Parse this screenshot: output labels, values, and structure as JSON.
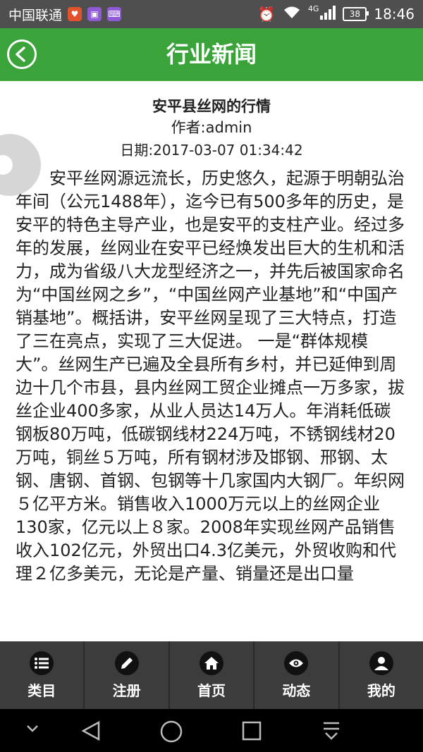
{
  "status_bar": {
    "carrier": "中国联通",
    "network": "4G",
    "battery": "38",
    "time": "18:46"
  },
  "header": {
    "title": "行业新闻"
  },
  "article": {
    "title": "安平县丝网的行情",
    "author": "作者:admin",
    "date": "日期:2017-03-07 01:34:42",
    "body": "安平丝网源远流长，历史悠久，起源于明朝弘治年间（公元1488年），迄今已有500多年的历史，是安平的特色主导产业，也是安平的支柱产业。经过多年的发展，丝网业在安平已经焕发出巨大的生机和活力，成为省级八大龙型经济之一，并先后被国家命名为“中国丝网之乡”，“中国丝网产业基地”和“中国产销基地”。概括讲，安平丝网呈现了三大特点，打造了三在亮点，实现了三大促进。 一是“群体规模大”。丝网生产已遍及全县所有乡村，并已延伸到周边十几个市县，县内丝网工贸企业摊点一万多家，拔丝企业400多家，从业人员达14万人。年消耗低碳钢板80万吨，低碳钢线材224万吨，不锈钢线材20万吨，铜丝５万吨，所有钢材涉及邯钢、邢钢、太钢、唐钢、首钢、包钢等十几家国内大钢厂。年织网５亿平方米。销售收入1000万元以上的丝网企业130家，亿元以上８家。2008年实现丝网产品销售收入102亿元，外贸出口4.3亿美元，外贸收购和代理２亿多美元，无论是产量、销量还是出口量"
  },
  "bottom_nav": {
    "items": [
      {
        "label": "类目",
        "icon": "list-icon"
      },
      {
        "label": "注册",
        "icon": "pencil-icon"
      },
      {
        "label": "首页",
        "icon": "home-icon"
      },
      {
        "label": "动态",
        "icon": "eye-icon"
      },
      {
        "label": "我的",
        "icon": "user-icon"
      }
    ]
  }
}
